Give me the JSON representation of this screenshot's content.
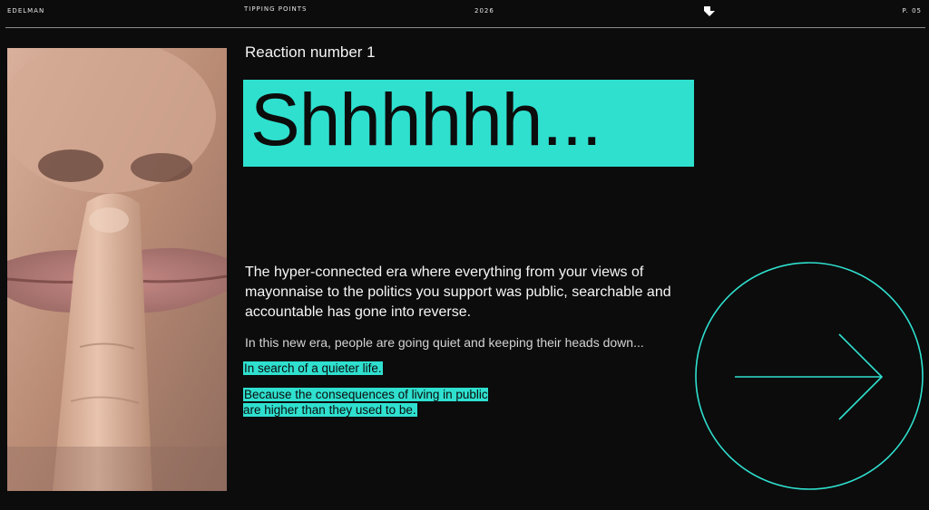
{
  "header": {
    "brand": "EDELMAN",
    "section": "TIPPING POINTS",
    "year": "2026",
    "page": "P. 05"
  },
  "main": {
    "reaction_label": "Reaction number 1",
    "title": "Shhhhhh...",
    "lead": "The hyper-connected era where everything from your views of mayonnaise to the politics you support was public, searchable and accountable has gone into reverse.",
    "subtext": "In this new era, people are going quiet and keeping their heads down...",
    "highlight_1": "In search of a quieter life.",
    "highlight_2": "Because the consequences of living in public are higher than they used to be."
  },
  "colors": {
    "accent": "#2fe0cf",
    "background": "#0c0c0c",
    "text": "#f2f2f2"
  },
  "icons": {
    "logo": "arrow-down-mark-icon",
    "next": "arrow-right-icon"
  }
}
